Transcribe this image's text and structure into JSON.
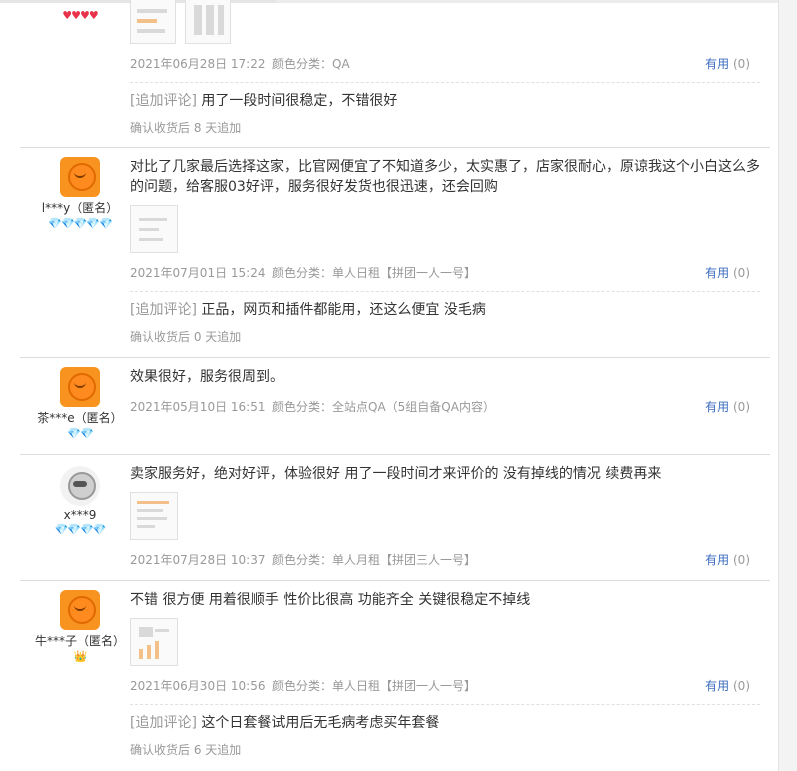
{
  "reviews": [
    {
      "user": {
        "name": "",
        "badge": "♥♥♥♥",
        "avatar": "none"
      },
      "text": "",
      "meta": {
        "date": "2021年06月28日 17:22",
        "color": "颜色分类：QA",
        "useful": "有用",
        "count": "(0)"
      },
      "append": {
        "tag": "[追加评论]",
        "text": " 用了一段时间很稳定，不错很好"
      },
      "after": "确认收货后 8 天追加"
    },
    {
      "user": {
        "name": "l***y（匿名）",
        "badge": "💎💎💎💎💎",
        "avatar": "orange"
      },
      "text": "对比了几家最后选择这家，比官网便宜了不知道多少，太实惠了，店家很耐心，原谅我这个小白这么多的问题，给客服03好评，服务很好发货也很迅速，还会回购",
      "meta": {
        "date": "2021年07月01日 15:24",
        "color": "颜色分类：单人日租【拼团一人一号】",
        "useful": "有用",
        "count": "(0)"
      },
      "append": {
        "tag": "[追加评论]",
        "text": " 正品，网页和插件都能用，还这么便宜 没毛病"
      },
      "after": "确认收货后 0 天追加"
    },
    {
      "user": {
        "name": "茶***e（匿名）",
        "badge": "💎💎",
        "avatar": "orange"
      },
      "text": "效果很好，服务很周到。",
      "meta": {
        "date": "2021年05月10日 16:51",
        "color": "颜色分类：全站点QA（5组自备QA内容）",
        "useful": "有用",
        "count": "(0)"
      }
    },
    {
      "user": {
        "name": "x***9",
        "badge": "💎💎💎💎",
        "avatar": "gray"
      },
      "text": "卖家服务好，绝对好评，体验很好 用了一段时间才来评价的 没有掉线的情况 续费再来",
      "meta": {
        "date": "2021年07月28日 10:37",
        "color": "颜色分类：单人月租【拼团三人一号】",
        "useful": "有用",
        "count": "(0)"
      }
    },
    {
      "user": {
        "name": "牛***子（匿名）",
        "badge": "👑",
        "avatar": "orange"
      },
      "text": "不错 很方便 用着很顺手 性价比很高 功能齐全 关键很稳定不掉线",
      "meta": {
        "date": "2021年06月30日 10:56",
        "color": "颜色分类：单人日租【拼团一人一号】",
        "useful": "有用",
        "count": "(0)"
      },
      "append": {
        "tag": "[追加评论]",
        "text": " 这个日套餐试用后无毛病考虑买年套餐"
      },
      "after": "确认收货后 6 天追加"
    }
  ],
  "colors": {
    "link": "#3c6dc0",
    "muted": "#999999",
    "gem": "#3fa3f0",
    "heart": "#e8334a"
  }
}
